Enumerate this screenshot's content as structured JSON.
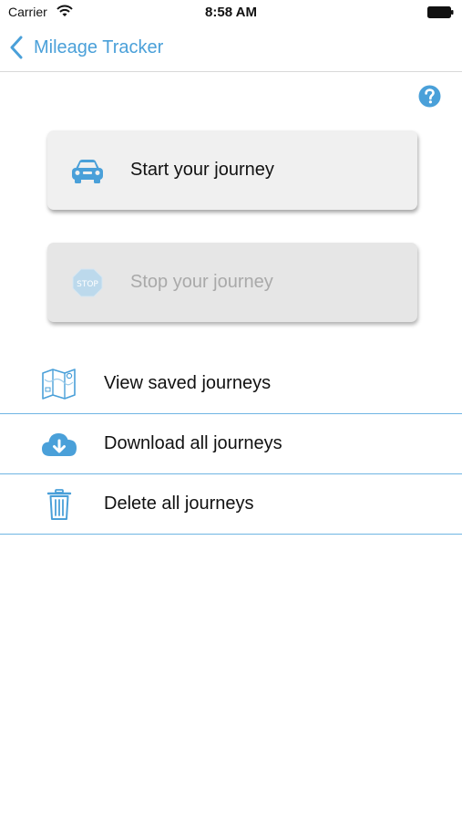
{
  "status_bar": {
    "carrier": "Carrier",
    "time": "8:58 AM"
  },
  "nav": {
    "back_title": "Mileage Tracker"
  },
  "buttons": {
    "start_label": "Start your journey",
    "stop_label": "Stop your journey",
    "stop_icon_text": "STOP"
  },
  "menu": {
    "items": [
      {
        "label": "View saved journeys",
        "icon": "map-icon"
      },
      {
        "label": "Download all journeys",
        "icon": "cloud-download-icon"
      },
      {
        "label": "Delete all journeys",
        "icon": "trash-icon"
      }
    ]
  },
  "colors": {
    "accent": "#4aa0d9",
    "divider": "#6fb5e3",
    "disabled_text": "#a9a9a9",
    "button_bg": "#f0f0f0",
    "button_disabled_bg": "#e6e6e6"
  }
}
